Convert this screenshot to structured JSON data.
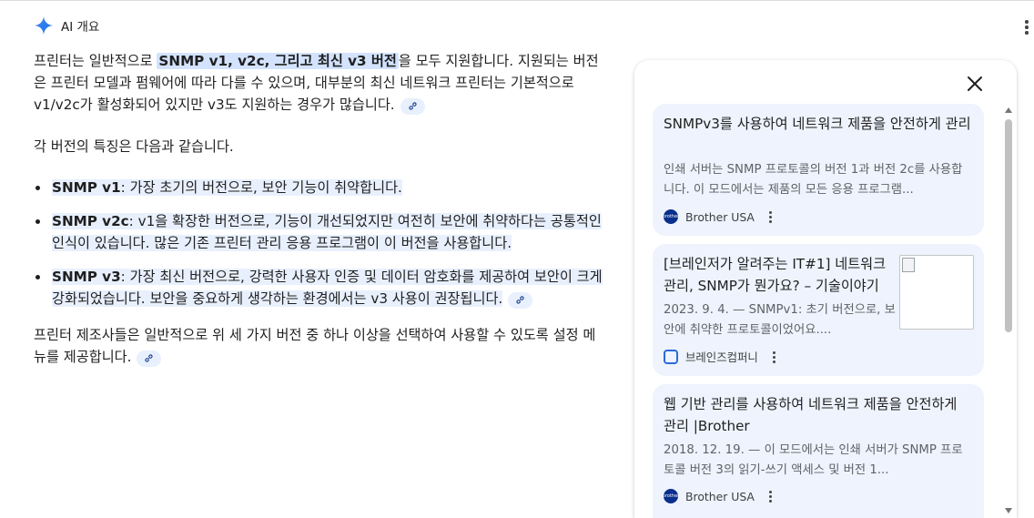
{
  "header": {
    "title": "AI 개요",
    "icon": "sparkle-icon"
  },
  "answer": {
    "p1_pre": "프린터는 일반적으로 ",
    "p1_hl": "SNMP v1, v2c, 그리고 최신 v3 버전",
    "p1_post": "을 모두 지원합니다. 지원되는 버전은 프린터 모델과 펌웨어에 따라 다를 수 있으며, 대부분의 최신 네트워크 프린터는 기본적으로 v1/v2c가 활성화되어 있지만 v3도 지원하는 경우가 많습니다.",
    "p2": "각 버전의 특징은 다음과 같습니다.",
    "bullets": [
      {
        "label": "SNMP v1",
        "text": ": 가장 초기의 버전으로, 보안 기능이 취약합니다."
      },
      {
        "label": "SNMP v2c",
        "text": ": v1을 확장한 버전으로, 기능이 개선되었지만 여전히 보안에 취약하다는 공통적인 인식이 있습니다. 많은 기존 프린터 관리 응용 프로그램이 이 버전을 사용합니다."
      },
      {
        "label": "SNMP v3",
        "text": ": 가장 최신 버전으로, 강력한 사용자 인증 및 데이터 암호화를 제공하여 보안이 크게 강화되었습니다. 보안을 중요하게 생각하는 환경에서는 v3 사용이 권장됩니다."
      }
    ],
    "p3": "프린터 제조사들은 일반적으로 위 세 가지 버전 중 하나 이상을 선택하여 사용할 수 있도록 설정 메뉴를 제공합니다."
  },
  "sources": [
    {
      "title": "SNMPv3를 사용하여 네트워크 제품을 안전하게 관리",
      "snippet": "인쇄 서버는 SNMP 프로토콜의 버전 1과 버전 2c를 사용합니다. 이 모드에서는 제품의 모든 응용 프로그램...",
      "source": "Brother USA",
      "logo_text": "brother"
    },
    {
      "title": "[브레인저가 알려주는 IT#1] 네트워크 관리, SNMP가 뭔가요? – 기술이야기",
      "snippet": "2023. 9. 4. — SNMPv1: 초기 버전으로, 보안에 취약한 프로토콜이었어요....",
      "source": "브레인즈컴퍼니"
    },
    {
      "title": "웹 기반 관리를 사용하여 네트워크 제품을 안전하게 관리 |Brother",
      "snippet": "2018. 12. 19. — 이 모드에서는 인쇄 서버가 SNMP 프로토콜 버전 3의 읽기-쓰기 액세스 및 버전 1...",
      "source": "Brother USA",
      "logo_text": "brother"
    }
  ],
  "colors": {
    "highlight": "#d3e3fd",
    "card_bg": "#eef3fd",
    "accent": "#4285f4"
  }
}
